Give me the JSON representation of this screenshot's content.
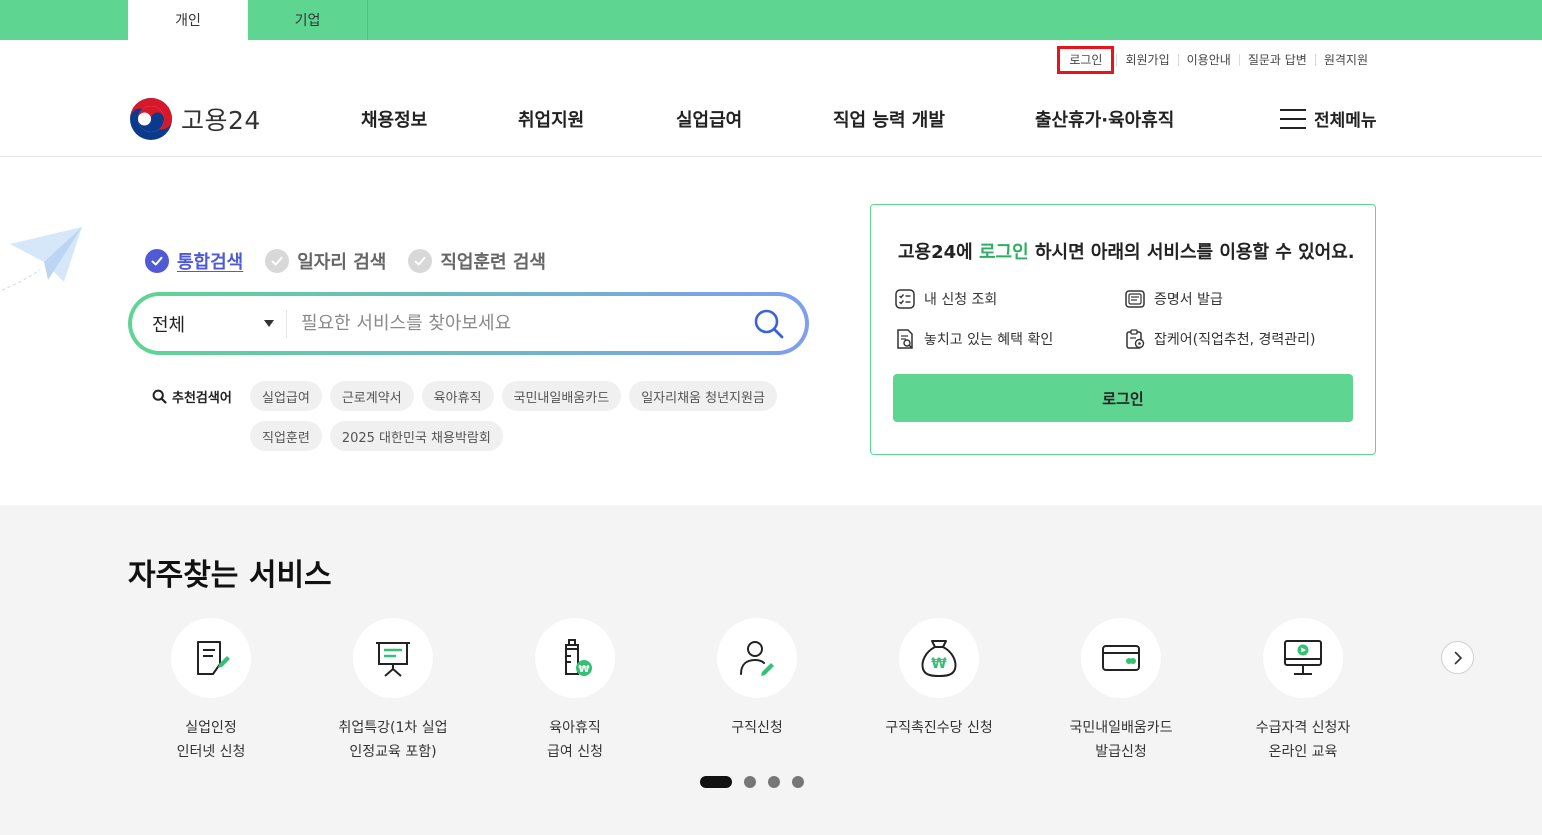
{
  "user_tabs": {
    "personal": "개인",
    "business": "기업"
  },
  "util_links": {
    "login": "로그인",
    "signup": "회원가입",
    "guide": "이용안내",
    "qna": "질문과 답변",
    "remote": "원격지원"
  },
  "logo": {
    "text": "고용24"
  },
  "nav": {
    "items": [
      "채용정보",
      "취업지원",
      "실업급여",
      "직업 능력 개발",
      "출산휴가·육아휴직"
    ],
    "all_menu": "전체메뉴"
  },
  "search": {
    "tabs": [
      "통합검색",
      "일자리 검색",
      "직업훈련 검색"
    ],
    "active_tab": "통합검색",
    "category": "전체",
    "placeholder": "필요한 서비스를 찾아보세요",
    "value": "",
    "recommend_label": "추천검색어",
    "keywords": [
      "실업급여",
      "근로계약서",
      "육아휴직",
      "국민내일배움카드",
      "일자리채움 청년지원금",
      "직업훈련",
      "2025 대한민국 채용박람회"
    ]
  },
  "login_box": {
    "msg_prefix": "고용24에 ",
    "msg_link": "로그인",
    "msg_suffix": " 하시면 아래의 서비스를 이용할 수 있어요.",
    "items": [
      "내 신청 조회",
      "증명서 발급",
      "놓치고 있는 혜택 확인",
      "잡케어(직업추천, 경력관리)"
    ],
    "button": "로그인"
  },
  "services": {
    "title": "자주찾는 서비스",
    "items": [
      {
        "label": "실업인정\n인터넷 신청",
        "icon": "document-pen-icon"
      },
      {
        "label": "취업특강(1차 실업\n인정교육 포함)",
        "icon": "presentation-board-icon"
      },
      {
        "label": "육아휴직\n급여 신청",
        "icon": "baby-bottle-icon"
      },
      {
        "label": "구직신청",
        "icon": "person-pen-icon"
      },
      {
        "label": "구직촉진수당 신청",
        "icon": "money-bag-icon"
      },
      {
        "label": "국민내일배움카드\n발급신청",
        "icon": "card-icon"
      },
      {
        "label": "수급자격 신청자\n온라인 교육",
        "icon": "monitor-play-icon"
      }
    ],
    "page_count": 4,
    "current_page": 1
  },
  "colors": {
    "brand_green": "#5fd592",
    "active_blue": "#4f5bd5",
    "highlight_red": "#e8141b"
  }
}
